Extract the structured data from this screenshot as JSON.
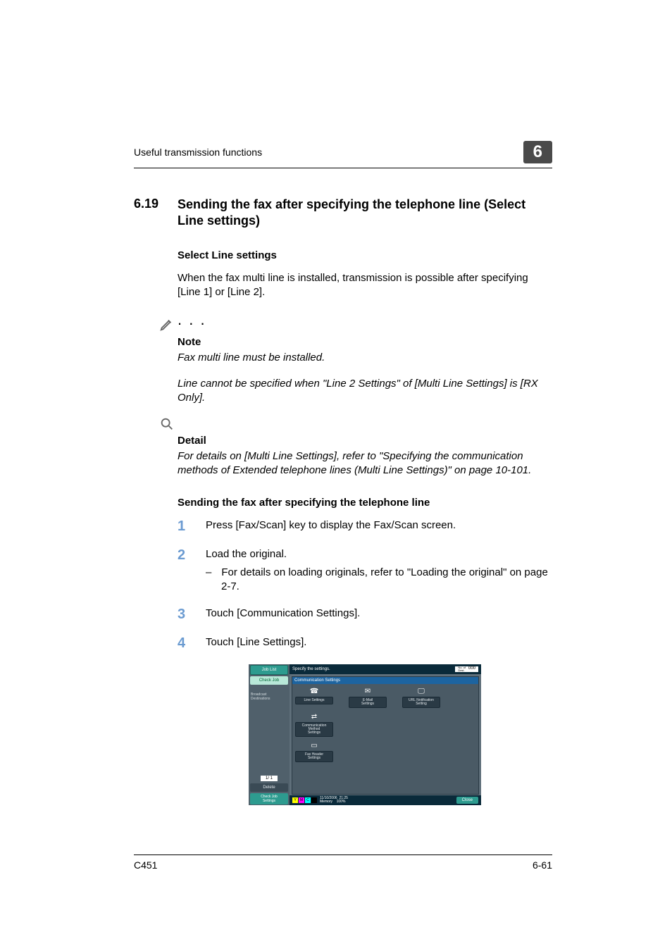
{
  "header": {
    "running": "Useful transmission functions",
    "chapter": "6"
  },
  "section": {
    "num": "6.19",
    "title": "Sending the fax after specifying the telephone line (Select Line settings)"
  },
  "sub1": {
    "head": "Select Line settings",
    "para": "When the fax multi line is installed, transmission is possible after specifying [Line 1] or [Line 2]."
  },
  "note": {
    "label": "Note",
    "p1": "Fax multi line must be installed.",
    "p2": "Line cannot be specified when \"Line 2 Settings\" of [Multi Line Settings] is [RX Only]."
  },
  "detail": {
    "label": "Detail",
    "p1": "For details on [Multi Line Settings], refer to \"Specifying the communication methods of Extended telephone lines (Multi Line Settings)\" on page 10-101."
  },
  "sub2": {
    "head": "Sending the fax after specifying the telephone line"
  },
  "steps": {
    "n1": "1",
    "t1": "Press [Fax/Scan] key to display the Fax/Scan screen.",
    "n2": "2",
    "t2": "Load the original.",
    "t2a": "For details on loading originals, refer to \"Loading the original\" on page 2-7.",
    "n3": "3",
    "t3": "Touch [Communication Settings].",
    "n4": "4",
    "t4": "Touch [Line Settings]."
  },
  "panel": {
    "job_list": "Job List",
    "check_job": "Check Job",
    "broadcast": "Broadcast\nDestinations",
    "counter": "1/    1",
    "delete": "Delete",
    "check_set": "Check Job\nSettings",
    "top": "Specify the settings.",
    "count_lbl": "No. of\nDest.",
    "count_val": "000",
    "title": "Communication Settings",
    "b1": "Line Settings",
    "b2": "E-Mail\nSettings",
    "b3": "URL Notification\nSetting",
    "b4": "Communication Method\nSettings",
    "b5": "Fax Header\nSettings",
    "date": "11/10/2006",
    "time": "21:25",
    "mem": "Memory",
    "memv": "100%",
    "close": "Close"
  },
  "footer": {
    "model": "C451",
    "page": "6-61"
  }
}
